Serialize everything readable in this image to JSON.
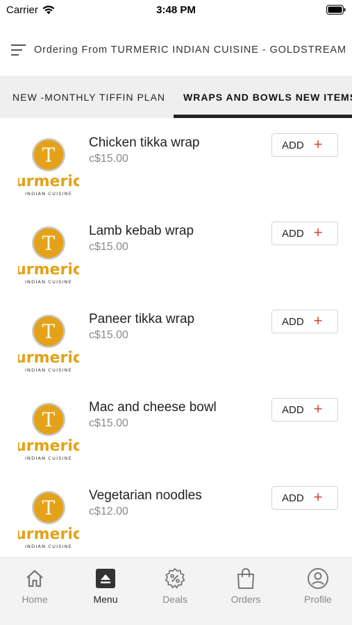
{
  "status_bar": {
    "carrier": "Carrier",
    "time": "3:48 PM"
  },
  "header": {
    "title": "Ordering From TURMERIC INDIAN CUISINE - GOLDSTREAM",
    "icon": "menu-lines-icon"
  },
  "tabs": [
    {
      "label": "NEW -MONTHLY TIFFIN PLAN",
      "active": false
    },
    {
      "label": "WRAPS AND BOWLS NEW ITEMS!",
      "active": true
    }
  ],
  "logo": {
    "brand": "urmeric",
    "sub": "INDIAN CUISINE",
    "letter": "T"
  },
  "items": [
    {
      "name": "Chicken tikka wrap",
      "price": "c$15.00",
      "add_label": "ADD"
    },
    {
      "name": "Lamb kebab wrap",
      "price": "c$15.00",
      "add_label": "ADD"
    },
    {
      "name": "Paneer tikka wrap",
      "price": "c$15.00",
      "add_label": "ADD"
    },
    {
      "name": "Mac and cheese bowl",
      "price": "c$15.00",
      "add_label": "ADD"
    },
    {
      "name": "Vegetarian noodles",
      "price": "c$12.00",
      "add_label": "ADD"
    }
  ],
  "bottom_nav": [
    {
      "label": "Home",
      "icon": "home-icon",
      "active": false
    },
    {
      "label": "Menu",
      "icon": "menu-icon",
      "active": true
    },
    {
      "label": "Deals",
      "icon": "deals-badge-icon",
      "active": false
    },
    {
      "label": "Orders",
      "icon": "shopping-bag-icon",
      "active": false
    },
    {
      "label": "Profile",
      "icon": "profile-icon",
      "active": false
    }
  ],
  "colors": {
    "accent_red": "#d9463a",
    "logo_gold": "#e3a21a",
    "tab_bar_bg": "#efefef",
    "nav_bg": "#f3f3f3"
  }
}
